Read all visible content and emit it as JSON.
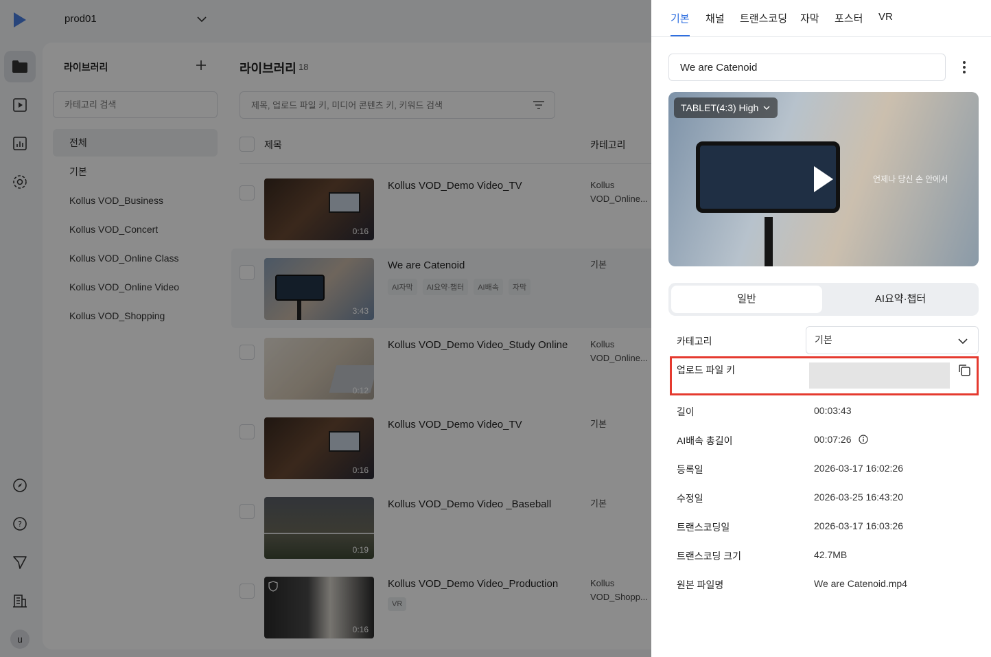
{
  "topbar": {
    "environment": "prod01"
  },
  "categories": {
    "title": "라이브러리",
    "search_placeholder": "카테고리 검색",
    "items": [
      "전체",
      "기본",
      "Kollus VOD_Business",
      "Kollus VOD_Concert",
      "Kollus VOD_Online Class",
      "Kollus VOD_Online Video",
      "Kollus VOD_Shopping"
    ]
  },
  "library": {
    "title": "라이브러리",
    "count": "18",
    "search_placeholder": "제목, 업로드 파일 키, 미디어 콘텐츠 키, 키워드 검색",
    "col_title": "제목",
    "col_category": "카테고리",
    "rows": [
      {
        "title": "Kollus VOD_Demo Video_TV",
        "duration": "0:16",
        "category_line1": "Kollus",
        "category_line2": "VOD_Online...",
        "tags": []
      },
      {
        "title": "We are Catenoid",
        "duration": "3:43",
        "category_line1": "기본",
        "category_line2": "",
        "tags": [
          "AI자막",
          "AI요약·챕터",
          "AI배속",
          "자막"
        ]
      },
      {
        "title": "Kollus VOD_Demo Video_Study Online",
        "duration": "0:12",
        "category_line1": "Kollus",
        "category_line2": "VOD_Online...",
        "tags": []
      },
      {
        "title": "Kollus VOD_Demo Video_TV",
        "duration": "0:16",
        "category_line1": "기본",
        "category_line2": "",
        "tags": []
      },
      {
        "title": "Kollus VOD_Demo Video _Baseball",
        "duration": "0:19",
        "category_line1": "기본",
        "category_line2": "",
        "tags": []
      },
      {
        "title": "Kollus VOD_Demo Video_Production",
        "duration": "0:16",
        "category_line1": "Kollus",
        "category_line2": "VOD_Shopp...",
        "tags": [
          "VR"
        ]
      }
    ]
  },
  "drawer": {
    "tabs": [
      "기본",
      "채널",
      "트랜스코딩",
      "자막",
      "포스터",
      "VR"
    ],
    "active_tab": "기본",
    "title_value": "We are Catenoid",
    "player": {
      "quality": "TABLET(4:3) High",
      "caption": "언제나 당신 손 안에서"
    },
    "segments": [
      "일반",
      "AI요약·챕터"
    ],
    "info": {
      "category_label": "카테고리",
      "category_value": "기본",
      "upload_key_label": "업로드 파일 키",
      "length_label": "길이",
      "length_value": "00:03:43",
      "ai_speed_label": "AI배속 총길이",
      "ai_speed_value": "00:07:26",
      "registered_label": "등록일",
      "registered_value": "2026-03-17 16:02:26",
      "modified_label": "수정일",
      "modified_value": "2026-03-25 16:43:20",
      "transcoded_label": "트랜스코딩일",
      "transcoded_value": "2026-03-17 16:03:26",
      "transcode_size_label": "트랜스코딩 크기",
      "transcode_size_value": "42.7MB",
      "original_file_label": "원본 파일명",
      "original_file_value": "We are Catenoid.mp4"
    }
  },
  "colors": {
    "accent": "#2f6fe0",
    "highlight": "#e53a2f",
    "logo": "#4a7fe0"
  }
}
